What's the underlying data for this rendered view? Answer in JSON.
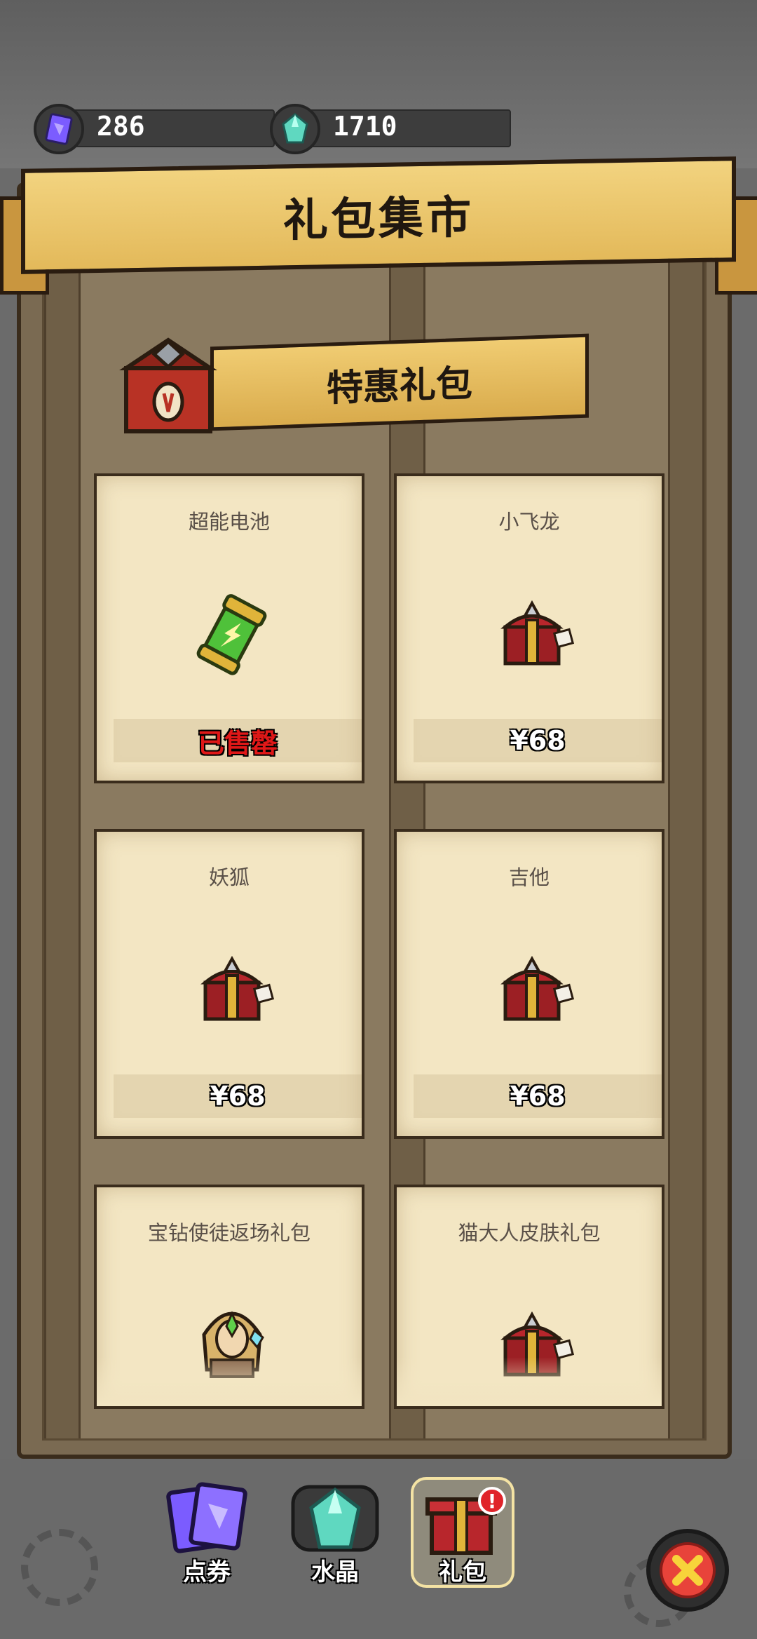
{
  "currencies": [
    {
      "name": "voucher",
      "value": "286"
    },
    {
      "name": "crystal",
      "value": "1710"
    }
  ],
  "header": {
    "title": "礼包集市"
  },
  "section": {
    "title": "特惠礼包"
  },
  "cards": [
    {
      "name": "超能电池",
      "price": "已售罄",
      "icon": "battery-icon"
    },
    {
      "name": "小飞龙",
      "price": "¥68",
      "icon": "treasure-chest-icon"
    },
    {
      "name": "妖狐",
      "price": "¥68",
      "icon": "treasure-chest-icon"
    },
    {
      "name": "吉他",
      "price": "¥68",
      "icon": "treasure-chest-icon"
    },
    {
      "name": "宝钻使徒返场礼包",
      "price": "",
      "icon": "character-icon"
    },
    {
      "name": "猫大人皮肤礼包",
      "price": "",
      "icon": "treasure-chest-icon"
    }
  ],
  "tabs": [
    {
      "label": "点券",
      "icon": "voucher-cards-icon"
    },
    {
      "label": "水晶",
      "icon": "crystal-icon"
    },
    {
      "label": "礼包",
      "icon": "gift-box-icon",
      "active": true
    }
  ],
  "colors": {
    "banner": "#e9c466",
    "card": "#f3e6c3",
    "board": "#7a6a52",
    "sold": "#e01818"
  }
}
